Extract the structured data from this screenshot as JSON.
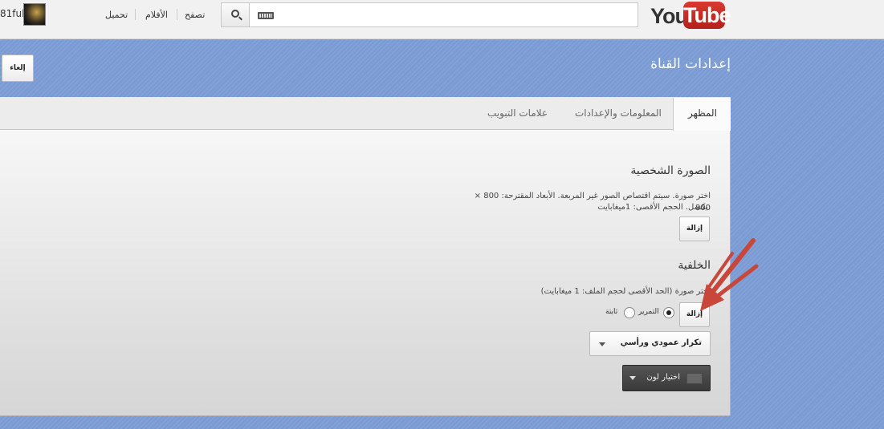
{
  "masthead": {
    "logo_you": "You",
    "logo_tube": "Tube",
    "search": {
      "value": "",
      "placeholder": ""
    },
    "nav": [
      "تصفح",
      "الأفلام",
      "تحميل"
    ],
    "user": {
      "name": "81ful"
    }
  },
  "header": {
    "title": "إعدادات القناة",
    "cancel_label": "إلغاء"
  },
  "tabs": [
    {
      "label": "المظهر",
      "active": true
    },
    {
      "label": "المعلومات والإعدادات",
      "active": false
    },
    {
      "label": "علامات التبويب",
      "active": false
    }
  ],
  "avatar_section": {
    "title": "الصورة الشخصية",
    "desc_line1": "اختر صورة. سيتم اقتصاص الصور غير المربعة. الأبعاد المقترحة: 800 × 800",
    "desc_line2": "بكسل. الحجم الأقصى: 1ميغابايت.",
    "remove_label": "إزالة"
  },
  "background_section": {
    "title": "الخلفية",
    "desc": "اختر صورة (الحد الأقصى لحجم الملف: 1 ميغابايت)",
    "remove_label": "إزالة",
    "radio_scroll_label": "التمرير",
    "radio_fixed_label": "ثابتة",
    "selected_option": "التمرير",
    "repeat_select_value": "تكرار عمودي ورأسي",
    "color_button_label": "اختيار لون"
  },
  "colors": {
    "page_background": "#7b9bd4",
    "annotation_arrow": "#c8463a",
    "youtube_red": "#c4302b"
  },
  "icons": [
    "search-icon",
    "keyboard-icon",
    "chevron-down-icon",
    "annotation-arrow"
  ]
}
